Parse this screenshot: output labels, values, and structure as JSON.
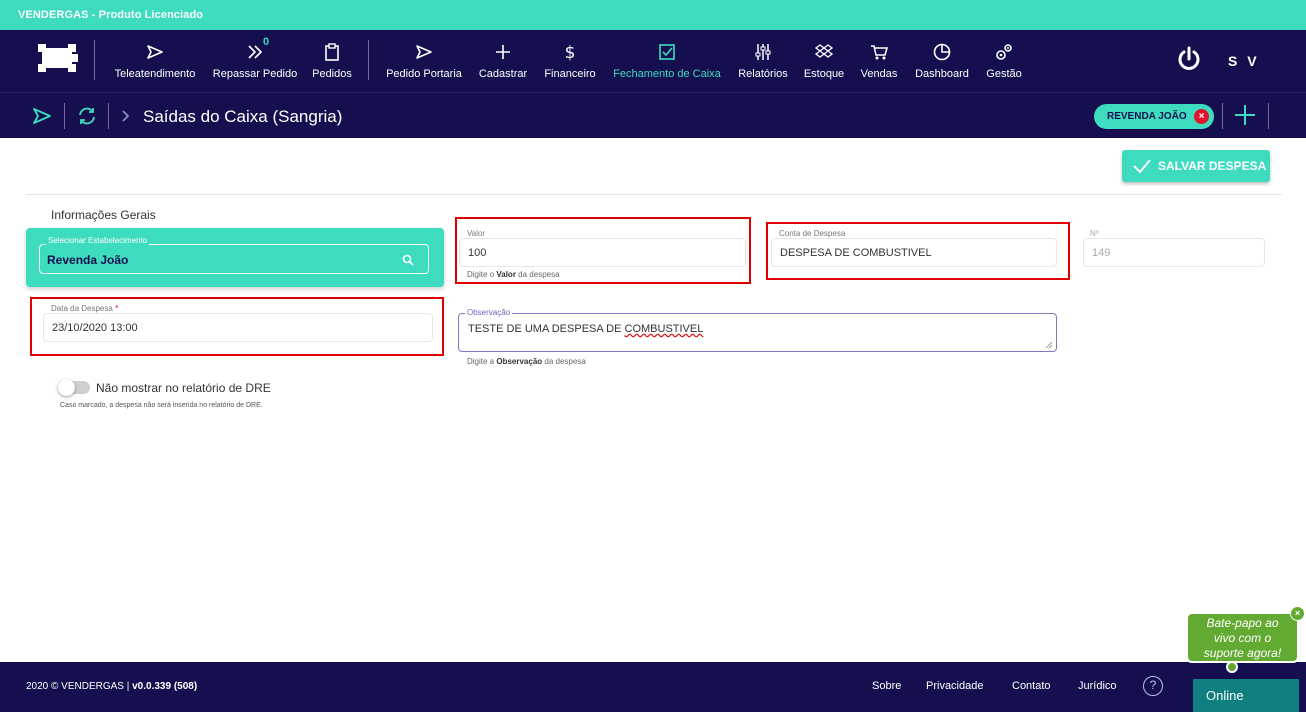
{
  "app": {
    "title": "VENDERGAS - Produto Licenciado"
  },
  "nav": {
    "items": [
      {
        "label": "Teleatendimento",
        "icon": "send-icon"
      },
      {
        "label": "Repassar Pedido",
        "icon": "double-chevron-icon",
        "badge": "0"
      },
      {
        "label": "Pedidos",
        "icon": "clipboard-icon"
      },
      {
        "label": "Pedido Portaria",
        "icon": "send-icon"
      },
      {
        "label": "Cadastrar",
        "icon": "plus-icon"
      },
      {
        "label": "Financeiro",
        "icon": "dollar-icon"
      },
      {
        "label": "Fechamento de Caixa",
        "icon": "checkbox-icon",
        "active": true
      },
      {
        "label": "Relatórios",
        "icon": "sliders-icon"
      },
      {
        "label": "Estoque",
        "icon": "dropbox-icon"
      },
      {
        "label": "Vendas",
        "icon": "cart-icon"
      },
      {
        "label": "Dashboard",
        "icon": "pie-chart-icon"
      },
      {
        "label": "Gestão",
        "icon": "gears-icon"
      }
    ],
    "user_initials": "S V"
  },
  "subbar": {
    "page_title": "Saídas do Caixa (Sangria)",
    "chip_label": "REVENDA JOÃO",
    "chip_close": "×"
  },
  "actions": {
    "save_label": "SALVAR DESPESA"
  },
  "form": {
    "section_title": "Informações Gerais",
    "estabelecimento": {
      "label": "Selecionar Estabelecimento",
      "value": "Revenda João"
    },
    "valor": {
      "label": "Valor",
      "value": "100",
      "hint_prefix": "Digite o",
      "hint_bold": "Valor",
      "hint_suffix": "da despesa"
    },
    "conta": {
      "label": "Conta de Despesa",
      "value": "DESPESA DE COMBUSTIVEL"
    },
    "numero": {
      "label": "Nº",
      "value": "149"
    },
    "data": {
      "label": "Data da Despesa",
      "required_mark": "*",
      "value": "23/10/2020 13:00"
    },
    "observacao": {
      "label": "Observação",
      "value_a": "TESTE DE UMA DESPESA DE ",
      "value_b": "COMBUSTIVEL",
      "hint_prefix": "Digite a",
      "hint_bold": "Observação",
      "hint_suffix": "da despesa"
    },
    "dre_toggle": {
      "label": "Não mostrar no relatório de DRE",
      "hint": "Caso marcado, a despesa não será inserida no relatório de DRE.",
      "checked": false
    }
  },
  "footer": {
    "copyright": "2020 © VENDERGAS |",
    "version": "v0.0.339 (508)",
    "links": [
      "Sobre",
      "Privacidade",
      "Contato",
      "Jurídico"
    ],
    "help": "?"
  },
  "chat": {
    "bubble_line1": "Bate-papo ao",
    "bubble_line2": "vivo com o",
    "bubble_line3": "suporte agora!",
    "close": "×",
    "online_label": "Online"
  },
  "colors": {
    "brand_teal": "#3ddcbf",
    "navy": "#150f4f",
    "highlight_red": "#e10000",
    "chat_green": "#63aa32"
  }
}
